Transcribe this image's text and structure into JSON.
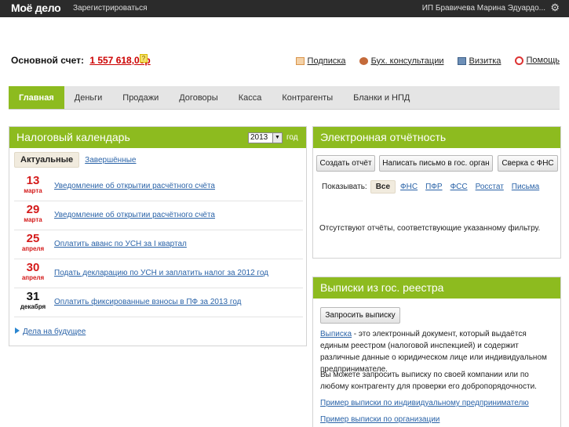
{
  "topbar": {
    "logo": "Моё дело",
    "register": "Зарегистрироваться",
    "user": "ИП Бравичева Марина Эдуардо...",
    "settings_icon": "gear-icon"
  },
  "account": {
    "label": "Основной счет:",
    "amount": "1 557 618,00р",
    "help": "?"
  },
  "toplinks": [
    {
      "label": "Подписка",
      "icon": "mail-icon"
    },
    {
      "label": "Бух. консультации",
      "icon": "people-icon"
    },
    {
      "label": "Визитка",
      "icon": "card-icon"
    },
    {
      "label": "Помощь",
      "icon": "help-icon"
    }
  ],
  "nav": {
    "tabs": [
      "Главная",
      "Деньги",
      "Продажи",
      "Договоры",
      "Касса",
      "Контрагенты",
      "Бланки и НПД"
    ],
    "active": "Главная"
  },
  "calendar": {
    "title": "Налоговый календарь",
    "year": "2013",
    "year_label": "год",
    "tab_active": "Актуальные",
    "tab_other": "Завершённые",
    "items": [
      {
        "day": "13",
        "month": "марта",
        "text": "Уведомление об открытии расчётного счёта",
        "color": "red"
      },
      {
        "day": "29",
        "month": "марта",
        "text": "Уведомление об открытии расчётного счёта",
        "color": "red"
      },
      {
        "day": "25",
        "month": "апреля",
        "text": "Оплатить аванс по УСН за I квартал",
        "color": "red"
      },
      {
        "day": "30",
        "month": "апреля",
        "text": "Подать декларацию по УСН и заплатить налог за 2012 год",
        "color": "red"
      },
      {
        "day": "31",
        "month": "декабря",
        "text": "Оплатить фиксированные взносы в ПФ за 2013 год",
        "color": "black"
      }
    ],
    "future_link": "Дела на будущее"
  },
  "reporting": {
    "title": "Электронная отчётность",
    "buttons": [
      "Создать отчёт",
      "Написать письмо в гос. орган",
      "Сверка с ФНС"
    ],
    "filter_label": "Показывать:",
    "filter_active": "Все",
    "filters": [
      "ФНС",
      "ПФР",
      "ФСС",
      "Росстат",
      "Письма"
    ],
    "empty_text": "Отсутствуют отчёты, соответствующие указанному фильтру."
  },
  "registry": {
    "title": "Выписки из гос. реестра",
    "button": "Запросить выписку",
    "p1_link": "Выписка",
    "p1_text": " - это электронный документ, который выдаётся единым реестром (налоговой инспекцией) и содержит различные данные о юридическом лице или индивидуальном предпринимателе.",
    "p2_text": "Вы можете запросить выписку по своей компании или по любому контрагенту для проверки его добропорядочности.",
    "link1": "Пример выписки по индивидуальному предпринимателю",
    "link2": "Пример выписки по организации"
  },
  "colors": {
    "accent": "#8dbb1f",
    "topbar": "#2b2b2b",
    "link": "#2a63a8",
    "date_red": "#d41a1a"
  }
}
